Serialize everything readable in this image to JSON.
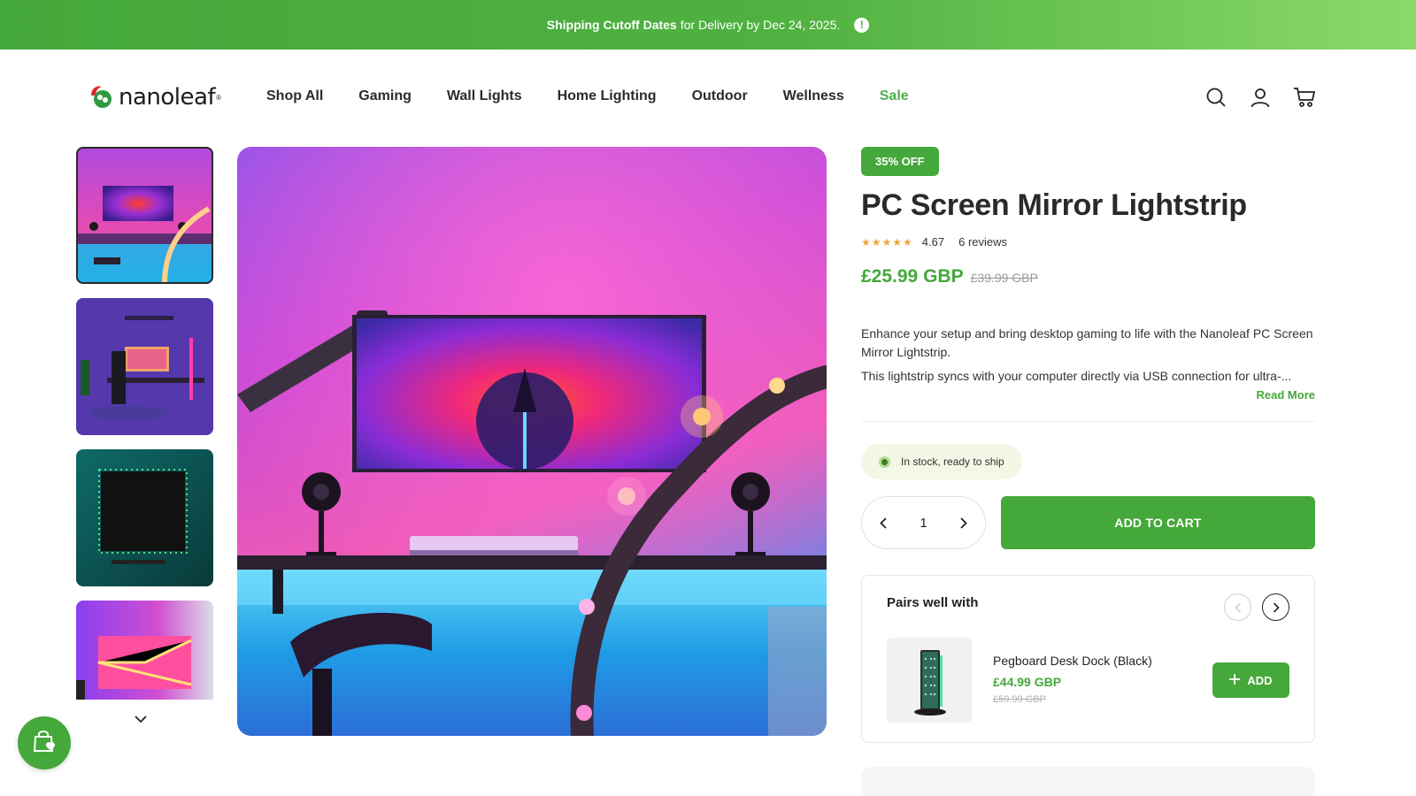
{
  "announcement": {
    "bold": "Shipping Cutoff Dates",
    "rest": "for Delivery by Dec 24, 2025.",
    "icon": "alert-circle-icon"
  },
  "logo": {
    "text": "nanoleaf",
    "reg": "®"
  },
  "nav": [
    {
      "label": "Shop All"
    },
    {
      "label": "Gaming"
    },
    {
      "label": "Wall Lights"
    },
    {
      "label": "Home Lighting"
    },
    {
      "label": "Outdoor"
    },
    {
      "label": "Wellness"
    },
    {
      "label": "Sale"
    }
  ],
  "header_icons": [
    "search-icon",
    "account-icon",
    "cart-icon"
  ],
  "colors": {
    "brand_green": "#45a83a",
    "sale_green": "#4caf50",
    "star": "#f2a33a"
  },
  "product": {
    "badge": "35% OFF",
    "title": "PC Screen Mirror Lightstrip",
    "rating": 4.67,
    "rating_text": "4.67",
    "stars": "★★★★★",
    "reviews": "6 reviews",
    "price": "£25.99 GBP",
    "old_price": "£39.99 GBP",
    "description_1": "Enhance your setup and bring desktop gaming to life with the Nanoleaf PC Screen Mirror Lightstrip.",
    "description_2": "This lightstrip syncs with your computer directly via USB connection for ultra-...",
    "read_more": "Read More",
    "stock": "In stock, ready to ship",
    "quantity": "1",
    "add_to_cart": "ADD TO CART"
  },
  "pairs": {
    "title": "Pairs well with",
    "item": {
      "name": "Pegboard Desk Dock (Black)",
      "price": "£44.99 GBP",
      "old_price": "£59.99 GBP",
      "add": "ADD"
    }
  }
}
